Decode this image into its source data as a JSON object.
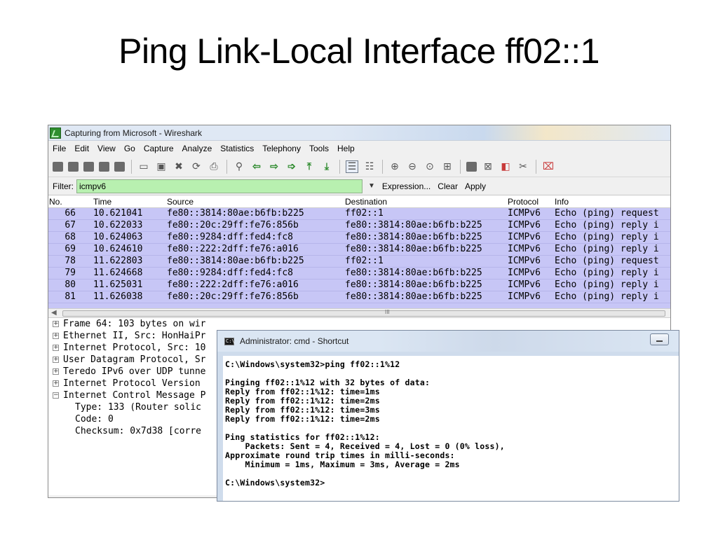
{
  "slide": {
    "title": "Ping Link-Local Interface ff02::1"
  },
  "wireshark": {
    "title": "Capturing from Microsoft - Wireshark",
    "menu": [
      "File",
      "Edit",
      "View",
      "Go",
      "Capture",
      "Analyze",
      "Statistics",
      "Telephony",
      "Tools",
      "Help"
    ],
    "filter": {
      "label": "Filter:",
      "value": "icmpv6",
      "expression": "Expression...",
      "clear": "Clear",
      "apply": "Apply"
    },
    "columns": {
      "no": "No.",
      "time": "Time",
      "source": "Source",
      "destination": "Destination",
      "protocol": "Protocol",
      "info": "Info"
    },
    "rows": [
      {
        "no": "66",
        "time": "10.621041",
        "source": "fe80::3814:80ae:b6fb:b225",
        "destination": "ff02::1",
        "protocol": "ICMPv6",
        "info": "Echo (ping) request"
      },
      {
        "no": "67",
        "time": "10.622033",
        "source": "fe80::20c:29ff:fe76:856b",
        "destination": "fe80::3814:80ae:b6fb:b225",
        "protocol": "ICMPv6",
        "info": "Echo (ping) reply i"
      },
      {
        "no": "68",
        "time": "10.624063",
        "source": "fe80::9284:dff:fed4:fc8",
        "destination": "fe80::3814:80ae:b6fb:b225",
        "protocol": "ICMPv6",
        "info": "Echo (ping) reply i"
      },
      {
        "no": "69",
        "time": "10.624610",
        "source": "fe80::222:2dff:fe76:a016",
        "destination": "fe80::3814:80ae:b6fb:b225",
        "protocol": "ICMPv6",
        "info": "Echo (ping) reply i"
      },
      {
        "no": "78",
        "time": "11.622803",
        "source": "fe80::3814:80ae:b6fb:b225",
        "destination": "ff02::1",
        "protocol": "ICMPv6",
        "info": "Echo (ping) request"
      },
      {
        "no": "79",
        "time": "11.624668",
        "source": "fe80::9284:dff:fed4:fc8",
        "destination": "fe80::3814:80ae:b6fb:b225",
        "protocol": "ICMPv6",
        "info": "Echo (ping) reply i"
      },
      {
        "no": "80",
        "time": "11.625031",
        "source": "fe80::222:2dff:fe76:a016",
        "destination": "fe80::3814:80ae:b6fb:b225",
        "protocol": "ICMPv6",
        "info": "Echo (ping) reply i"
      },
      {
        "no": "81",
        "time": "11.626038",
        "source": "fe80::20c:29ff:fe76:856b",
        "destination": "fe80::3814:80ae:b6fb:b225",
        "protocol": "ICMPv6",
        "info": "Echo (ping) reply i"
      }
    ],
    "details": [
      {
        "expander": "+",
        "text": "Frame 64: 103 bytes on wir"
      },
      {
        "expander": "+",
        "text": "Ethernet II, Src: HonHaiPr"
      },
      {
        "expander": "+",
        "text": "Internet Protocol, Src: 10"
      },
      {
        "expander": "+",
        "text": "User Datagram Protocol, Sr"
      },
      {
        "expander": "+",
        "text": "Teredo IPv6 over UDP tunne"
      },
      {
        "expander": "+",
        "text": "Internet Protocol Version"
      },
      {
        "expander": "−",
        "text": "Internet Control Message P"
      }
    ],
    "detail_sub": [
      "Type: 133 (Router solic",
      "Code: 0",
      "Checksum: 0x7d38 [corre"
    ]
  },
  "cmd": {
    "title": "Administrator: cmd - Shortcut",
    "lines": [
      "C:\\Windows\\system32>ping ff02::1%12",
      "",
      "Pinging ff02::1%12 with 32 bytes of data:",
      "Reply from ff02::1%12: time=1ms",
      "Reply from ff02::1%12: time=2ms",
      "Reply from ff02::1%12: time=3ms",
      "Reply from ff02::1%12: time=2ms",
      "",
      "Ping statistics for ff02::1%12:",
      "    Packets: Sent = 4, Received = 4, Lost = 0 (0% loss),",
      "Approximate round trip times in milli-seconds:",
      "    Minimum = 1ms, Maximum = 3ms, Average = 2ms",
      "",
      "C:\\Windows\\system32>"
    ]
  }
}
